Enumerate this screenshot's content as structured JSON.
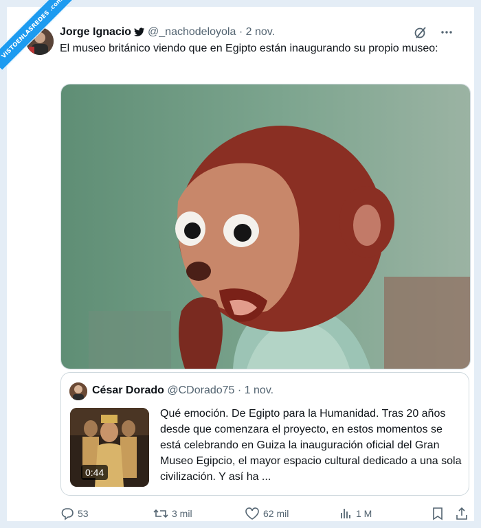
{
  "watermark": {
    "text": "VISTOENLASREDES .com"
  },
  "tweet": {
    "author_name": "Jorge Ignacio",
    "handle": "@_nachodeloyola",
    "separator": "·",
    "date": "2 nov.",
    "text": "El museo británico viendo que en Egipto están inaugurando su propio museo:"
  },
  "quote": {
    "author_name": "César Dorado",
    "handle": "@CDorado75",
    "separator": "·",
    "date": "1 nov.",
    "video_duration": "0:44",
    "text": "Qué emoción. De Egipto para la Humanidad. Tras 20 años desde que comenzara el proyecto, en estos momentos se está celebrando en Guiza la inauguración oficial del Gran Museo Egipcio, el mayor espacio cultural dedicado a una sola civilización. Y así ha ..."
  },
  "actions": {
    "replies": "53",
    "retweets": "3 mil",
    "likes": "62 mil",
    "views": "1 M"
  },
  "icons": [
    "verified-bird-icon",
    "grok-icon",
    "more-icon",
    "reply-icon",
    "retweet-icon",
    "like-icon",
    "views-icon",
    "bookmark-icon",
    "share-icon"
  ],
  "colors": {
    "accent": "#1d9bf0",
    "text": "#0f1419",
    "muted": "#536471",
    "border": "#cfd9de",
    "frame": "#e4edf6"
  }
}
